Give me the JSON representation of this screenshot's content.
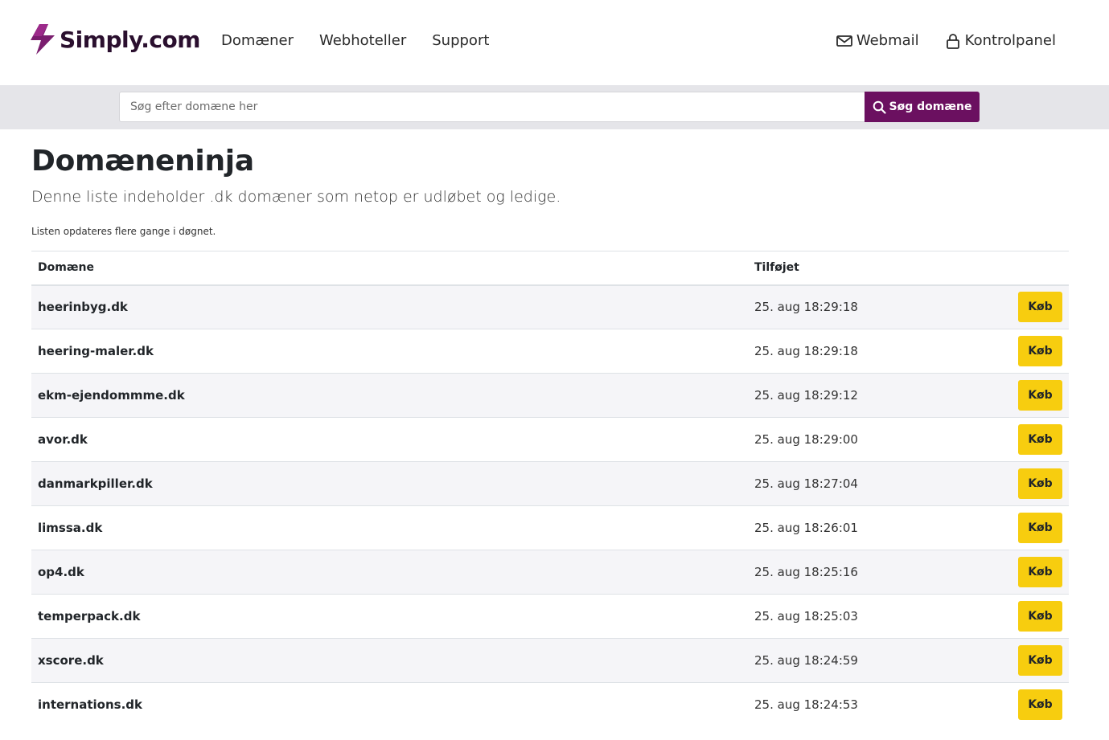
{
  "header": {
    "logo_text": "Simply.com",
    "nav": [
      "Domæner",
      "Webhoteller",
      "Support"
    ],
    "webmail_label": "Webmail",
    "kontrolpanel_label": "Kontrolpanel"
  },
  "search": {
    "placeholder": "Søg efter domæne her",
    "button_label": "Søg domæne"
  },
  "page": {
    "title": "Domæneninja",
    "lead": "Denne liste indeholder .dk domæner som netop er udløbet og ledige.",
    "note": "Listen opdateres flere gange i døgnet."
  },
  "table": {
    "headers": {
      "domain": "Domæne",
      "added": "Tilføjet"
    },
    "buy_label": "Køb",
    "rows": [
      {
        "domain": "heerinbyg.dk",
        "added": "25. aug 18:29:18"
      },
      {
        "domain": "heering-maler.dk",
        "added": "25. aug 18:29:18"
      },
      {
        "domain": "ekm-ejendommme.dk",
        "added": "25. aug 18:29:12"
      },
      {
        "domain": "avor.dk",
        "added": "25. aug 18:29:00"
      },
      {
        "domain": "danmarkpiller.dk",
        "added": "25. aug 18:27:04"
      },
      {
        "domain": "limssa.dk",
        "added": "25. aug 18:26:01"
      },
      {
        "domain": "op4.dk",
        "added": "25. aug 18:25:16"
      },
      {
        "domain": "temperpack.dk",
        "added": "25. aug 18:25:03"
      },
      {
        "domain": "xscore.dk",
        "added": "25. aug 18:24:59"
      },
      {
        "domain": "internations.dk",
        "added": "25. aug 18:24:53"
      }
    ]
  },
  "colors": {
    "brand": "#6b1060",
    "buy_button": "#f7cd0f",
    "search_band": "#e5e5e9"
  },
  "icons": {
    "logo": "lightning-bolt-logo-icon",
    "webmail": "envelope-icon",
    "kontrolpanel": "lock-icon",
    "search": "search-icon"
  }
}
